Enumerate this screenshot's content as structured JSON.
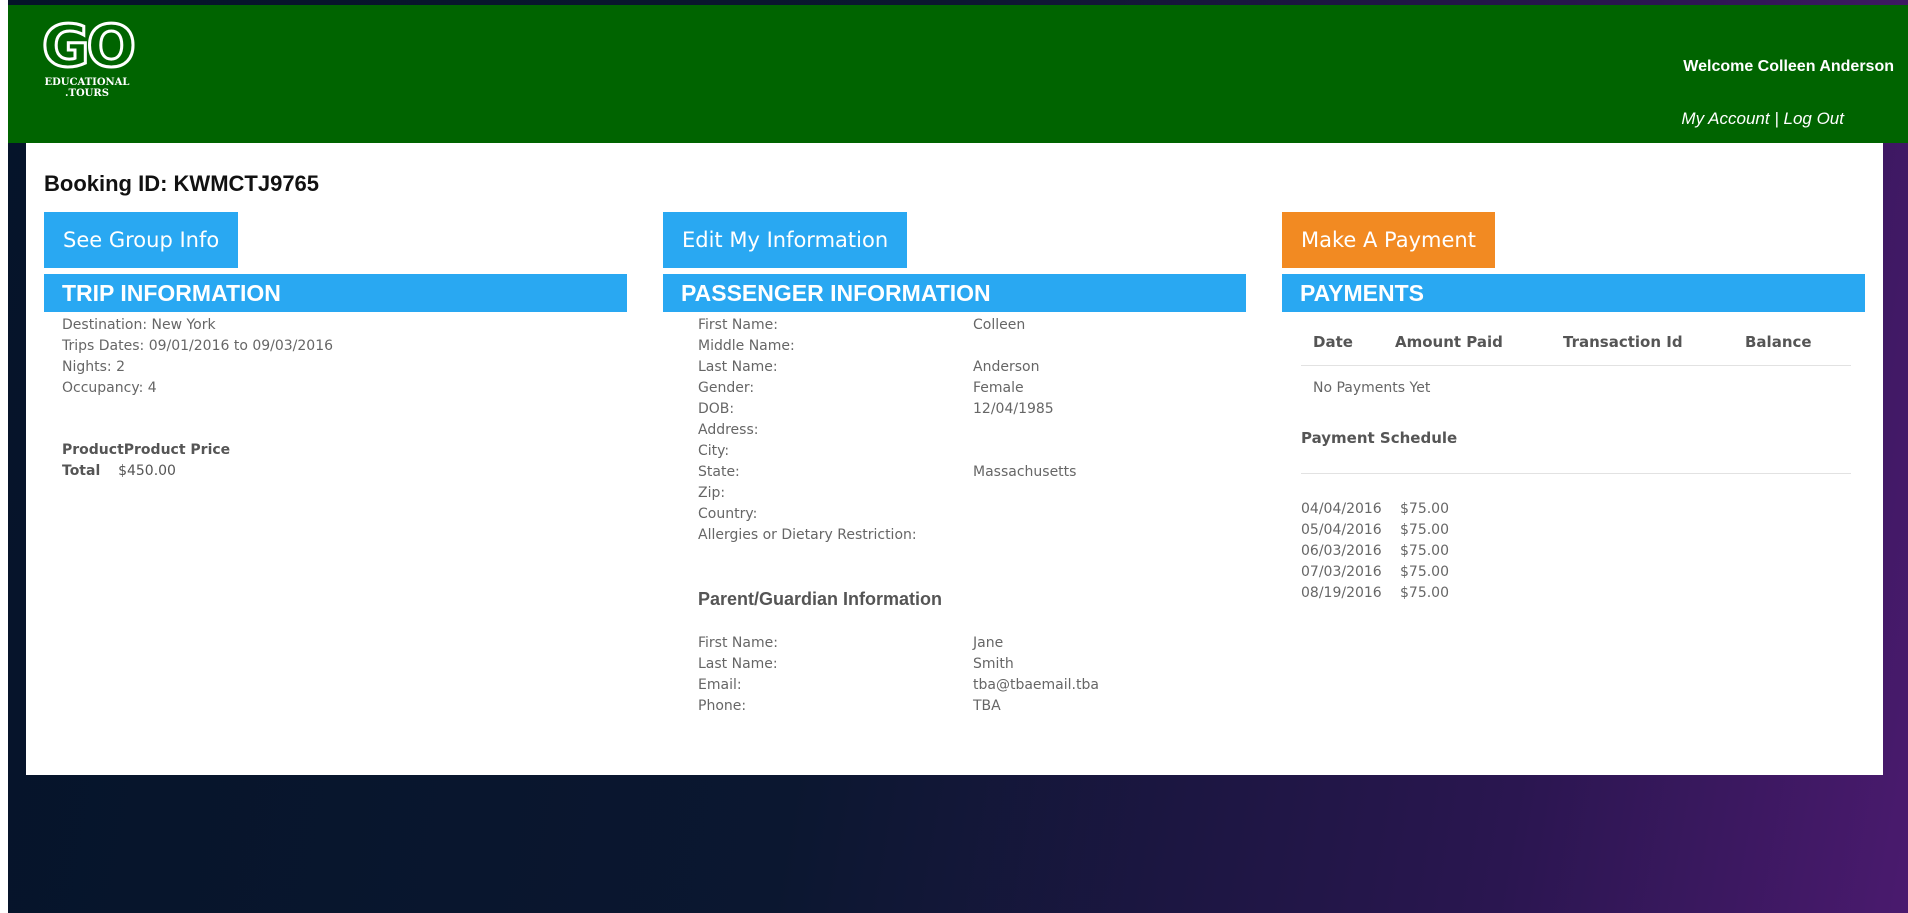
{
  "header": {
    "logo_main": "GO",
    "logo_line1": "EDUCATIONAL",
    "logo_line2": ".TOURS",
    "welcome": "Welcome Colleen Anderson",
    "my_account": "My Account",
    "separator": "|",
    "log_out": "Log Out"
  },
  "booking": {
    "label": "Booking ID: KWMCTJ9765"
  },
  "buttons": {
    "group_info": "See Group Info",
    "edit_info": "Edit My Information",
    "make_payment": "Make A Payment"
  },
  "sections": {
    "trip": "TRIP INFORMATION",
    "passenger": "PASSENGER INFORMATION",
    "payments": "PAYMENTS"
  },
  "trip": {
    "destination": "Destination: New York",
    "dates": "Trips Dates: 09/01/2016 to 09/03/2016",
    "nights": "Nights: 2",
    "occupancy": "Occupancy: 4",
    "product_header": "ProductProduct Price",
    "total_label": "Total",
    "total_value": "$450.00"
  },
  "passenger": {
    "rows": [
      {
        "label": "First Name:",
        "value": "Colleen"
      },
      {
        "label": "Middle Name:",
        "value": ""
      },
      {
        "label": "Last Name:",
        "value": "Anderson"
      },
      {
        "label": "Gender:",
        "value": "Female"
      },
      {
        "label": "DOB:",
        "value": "12/04/1985"
      },
      {
        "label": "Address:",
        "value": ""
      },
      {
        "label": "City:",
        "value": ""
      },
      {
        "label": "State:",
        "value": "Massachusetts"
      },
      {
        "label": "Zip:",
        "value": ""
      },
      {
        "label": "Country:",
        "value": ""
      },
      {
        "label": "Allergies or Dietary Restriction:",
        "value": ""
      }
    ]
  },
  "guardian": {
    "title": "Parent/Guardian Information",
    "rows": [
      {
        "label": "First Name:",
        "value": "Jane"
      },
      {
        "label": "Last Name:",
        "value": "Smith"
      },
      {
        "label": "Email:",
        "value": "tba@tbaemail.tba"
      },
      {
        "label": "Phone:",
        "value": "TBA"
      }
    ]
  },
  "payments": {
    "columns": [
      "Date",
      "Amount Paid",
      "Transaction Id",
      "Balance"
    ],
    "empty_text": "No Payments Yet",
    "schedule_title": "Payment Schedule",
    "schedule": [
      {
        "date": "04/04/2016",
        "amount": "$75.00"
      },
      {
        "date": "05/04/2016",
        "amount": "$75.00"
      },
      {
        "date": "06/03/2016",
        "amount": "$75.00"
      },
      {
        "date": "07/03/2016",
        "amount": "$75.00"
      },
      {
        "date": "08/19/2016",
        "amount": "$75.00"
      }
    ]
  }
}
